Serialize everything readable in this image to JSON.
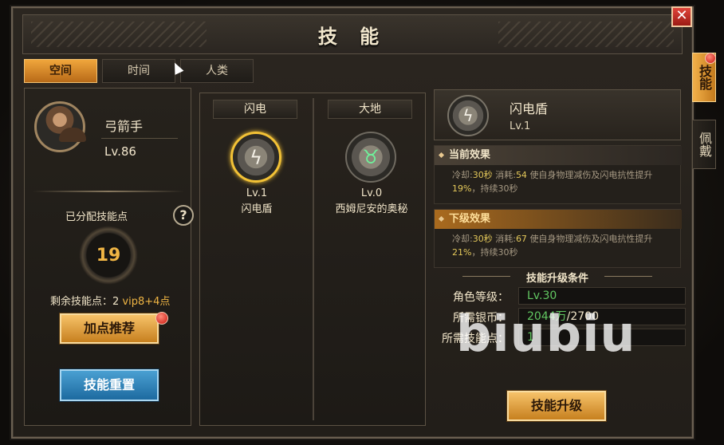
{
  "window": {
    "title": "技 能",
    "close_glyph": "✕"
  },
  "tabs": [
    {
      "label": "空间",
      "active": true
    },
    {
      "label": "时间",
      "active": false
    },
    {
      "label": "人类",
      "active": false
    }
  ],
  "side_tabs": [
    {
      "label": "技能",
      "active": true
    },
    {
      "label": "佩戴",
      "active": false
    }
  ],
  "hero": {
    "class_name": "弓箭手",
    "level": "Lv.86",
    "allocated_label": "已分配技能点",
    "allocated_points": "19",
    "remaining_label": "剩余技能点：2",
    "remaining_vip": "vip8+4点",
    "recommend_button": "加点推荐",
    "reset_button": "技能重置"
  },
  "skill_columns": [
    {
      "header": "闪电",
      "skill_level": "Lv.1",
      "skill_name": "闪电盾",
      "icon": "lightning-icon",
      "glyph": "ϟ",
      "selected": true
    },
    {
      "header": "大地",
      "skill_level": "Lv.0",
      "skill_name": "西姆尼安的奥秘",
      "icon": "earth-horns-icon",
      "glyph": "♉",
      "selected": false
    }
  ],
  "detail": {
    "name": "闪电盾",
    "level": "Lv.1",
    "icon_glyph": "ϟ",
    "current": {
      "title": "当前效果",
      "cd_label": "冷却:",
      "cd": "30秒",
      "cost_label": "消耗:",
      "cost": "54",
      "desc_a": "使自身物理减伤及闪电抗性提升",
      "pct": "19%",
      "desc_b": "，持续30秒"
    },
    "next": {
      "title": "下级效果",
      "cd_label": "冷却:",
      "cd": "30秒",
      "cost_label": "消耗:",
      "cost": "67",
      "desc_a": "使自身物理减伤及闪电抗性提升",
      "pct": "21%",
      "desc_b": "，持续30秒"
    },
    "upgrade_title": "技能升级条件",
    "requirements": [
      {
        "label": "角色等级：",
        "value": "Lv.30",
        "suffix": ""
      },
      {
        "label": "所需银币：",
        "value": "2044万",
        "suffix": "/2700"
      },
      {
        "label": "所需技能点：",
        "value": "1",
        "suffix": ""
      }
    ],
    "upgrade_button": "技能升级"
  },
  "watermark": "biubiu",
  "colors": {
    "accent_gold": "#f0b544",
    "active_tab": "#e89a34",
    "req_green": "#62c862",
    "reset_blue": "#2f86be"
  }
}
